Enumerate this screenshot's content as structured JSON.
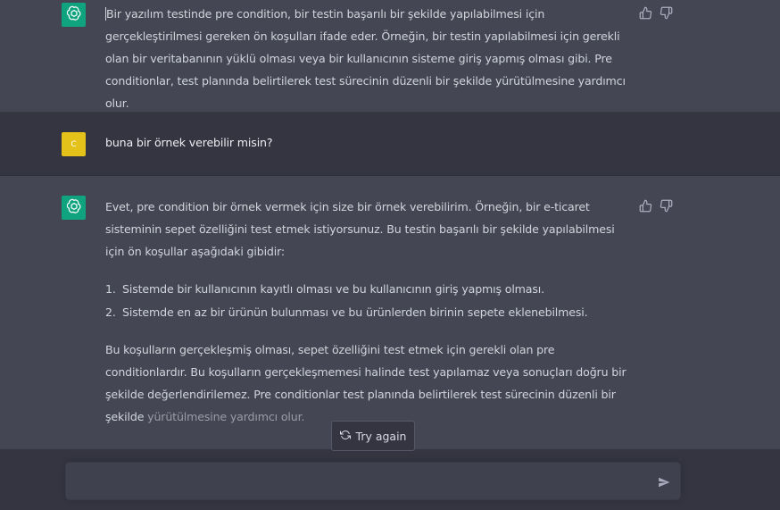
{
  "messages": [
    {
      "role": "assistant",
      "paragraphs": [
        "Bir yazılım testinde pre condition, bir testin başarılı bir şekilde yapılabilmesi için gerçekleştirilmesi gereken ön koşulları ifade eder. Örneğin, bir testin yapılabilmesi için gerekli olan bir veritabanının yüklü olması veya bir kullanıcının sisteme giriş yapmış olması gibi. Pre conditionlar, test planında belirtilerek test sürecinin düzenli bir şekilde yürütülmesine yardımcı olur."
      ]
    },
    {
      "role": "user",
      "avatar_letter": "C",
      "text": "buna bir örnek verebilir misin?"
    },
    {
      "role": "assistant",
      "intro": "Evet, pre condition bir örnek vermek için size bir örnek verebilirim. Örneğin, bir e-ticaret sisteminin sepet özelliğini test etmek istiyorsunuz. Bu testin başarılı bir şekilde yapılabilmesi için ön koşullar aşağıdaki gibidir:",
      "list": [
        {
          "num": "1.",
          "text": "Sistemde bir kullanıcının kayıtlı olması ve bu kullanıcının giriş yapmış olması."
        },
        {
          "num": "2.",
          "text": "Sistemde en az bir ürünün bulunması ve bu ürünlerden birinin sepete eklenebilmesi."
        }
      ],
      "outro_main": "Bu koşulların gerçekleşmiş olması, sepet özelliğini test etmek için gerekli olan pre conditionlardır. Bu koşulların gerçekleşmemesi halinde test yapılamaz veya sonuçları doğru bir şekilde değerlendirilemez. Pre conditionlar test planında belirtilerek test sürecinin düzenli bir şekilde",
      "outro_faded": "yürütülmesine yardımcı olur."
    }
  ],
  "try_again_label": "Try again",
  "composer": {
    "value": "",
    "placeholder": ""
  },
  "colors": {
    "assistant_bg": "#444654",
    "user_bg": "#343541",
    "gpt_avatar": "#10a37f",
    "user_avatar": "#e4c21a"
  },
  "icons": [
    "openai-logo-icon",
    "thumbs-up-icon",
    "thumbs-down-icon",
    "refresh-icon",
    "send-icon"
  ]
}
